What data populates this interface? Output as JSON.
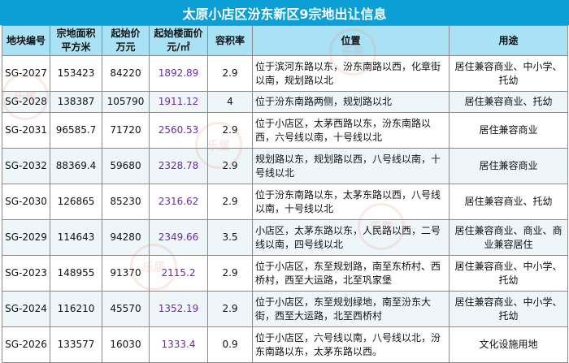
{
  "title": "太原小店区汾东新区9宗地出让信息",
  "headers": [
    {
      "line1": "地块编号",
      "line2": ""
    },
    {
      "line1": "宗地面积",
      "line2": "平方米"
    },
    {
      "line1": "起始价",
      "line2": "万元"
    },
    {
      "line1": "起始楼面价",
      "line2": "元/㎡"
    },
    {
      "line1": "容积率",
      "line2": ""
    },
    {
      "line1": "位置",
      "line2": ""
    },
    {
      "line1": "用途",
      "line2": ""
    }
  ],
  "rows": [
    {
      "id": "SG-2027",
      "area": "153423",
      "price": "84220",
      "floor_price": "1892.89",
      "far": "2.9",
      "location": "位于滨河东路以东，汾东南路以西，化章街以南，规划路以北",
      "use": "居住兼容商业、中小学、托幼"
    },
    {
      "id": "SG-2028",
      "area": "138387",
      "price": "105790",
      "floor_price": "1911.12",
      "far": "4",
      "location": "位于汾东南路两侧，规划路以北",
      "use": "居住兼容商业、托幼"
    },
    {
      "id": "SG-2031",
      "area": "96585.7",
      "price": "71720",
      "floor_price": "2560.53",
      "far": "2.9",
      "location": "位于小店区，太茅西路以东，汾东南路以西，六号线以南，十号线以北",
      "use": "居住兼容商业"
    },
    {
      "id": "SG-2032",
      "area": "88369.4",
      "price": "59680",
      "floor_price": "2328.78",
      "far": "2.9",
      "location": "规划路以东，规划路以西，八号线以南，十号线以北",
      "use": "居住兼容商业"
    },
    {
      "id": "SG-2030",
      "area": "126865",
      "price": "85230",
      "floor_price": "2316.62",
      "far": "2.9",
      "location": "位于汾东南路以东，太茅东路以西，八号线以南，十号线以北",
      "use": "居住兼容商业、托幼"
    },
    {
      "id": "SG-2029",
      "area": "114643",
      "price": "94280",
      "floor_price": "2349.66",
      "far": "3.5",
      "location": "小店区，太茅东路以东，人民路以西，二号线以南，四号线以北",
      "use": "居住兼容商业、商业、商业兼容居住"
    },
    {
      "id": "SG-2023",
      "area": "148955",
      "price": "91370",
      "floor_price": "2115.2",
      "far": "2.9",
      "location": "位于小店区，东至规划路，南至东桥村、西桥村，西至大运路，北至巩家堡",
      "use": "居住兼容商业、中小学、托幼"
    },
    {
      "id": "SG-2024",
      "area": "116210",
      "price": "45570",
      "floor_price": "1352.19",
      "far": "2.9",
      "location": "位于小店区，东至规划绿地，南至汾东大街，西至大运路，北至西桥村",
      "use": "居住兼容商业、中小学、托幼"
    },
    {
      "id": "SG-2026",
      "area": "133577",
      "price": "16030",
      "floor_price": "1333.4",
      "far": "0.9",
      "location": "位于小店区，六号线以南，八号线以北，汾东南路以东，太茅东路以西。",
      "use": "文化设施用地"
    }
  ],
  "row_heights": [
    "double",
    "single",
    "double",
    "double",
    "double",
    "double",
    "double",
    "double",
    "double"
  ],
  "watermark_text": "乐居",
  "colors": {
    "header_bg": "#0b9fd6",
    "subheader_bg": "#a9e2f5",
    "price_text": "#6b2aa6"
  }
}
